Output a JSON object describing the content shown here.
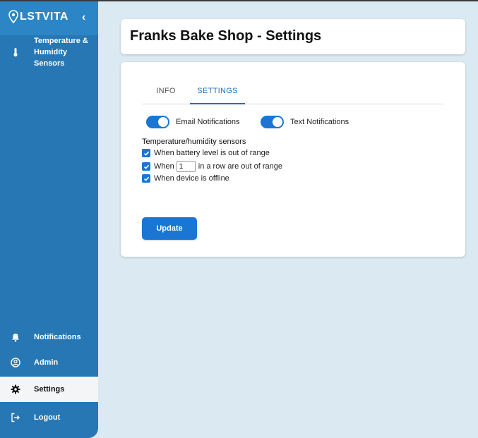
{
  "brand": {
    "logo_text": "LSTVITA"
  },
  "sidebar": {
    "collapse_glyph": "‹",
    "items": [
      {
        "label": "Temperature & Humidity Sensors",
        "icon": "thermometer-icon"
      },
      {
        "label": "Notifications",
        "icon": "bell-icon"
      },
      {
        "label": "Admin",
        "icon": "user-circle-icon"
      },
      {
        "label": "Settings",
        "icon": "gear-icon",
        "active": true
      },
      {
        "label": "Logout",
        "icon": "logout-icon"
      }
    ]
  },
  "page": {
    "title": "Franks Bake Shop - Settings"
  },
  "tabs": [
    {
      "label": "INFO"
    },
    {
      "label": "SETTINGS",
      "active": true
    }
  ],
  "toggles": {
    "email_label": "Email Notifications",
    "email_on": true,
    "text_label": "Text Notifications",
    "text_on": true
  },
  "sensors": {
    "heading": "Temperature/humidity sensors",
    "battery_label": "When battery level is out of range",
    "battery_checked": true,
    "row_prefix": "When",
    "row_count": "1",
    "row_suffix": "in a row are out of range",
    "row_checked": true,
    "offline_label": "When device is offline",
    "offline_checked": true
  },
  "actions": {
    "update_label": "Update"
  },
  "colors": {
    "sidebar": "#2677b4",
    "accent": "#1a76d2",
    "background": "#dbe9f2"
  }
}
